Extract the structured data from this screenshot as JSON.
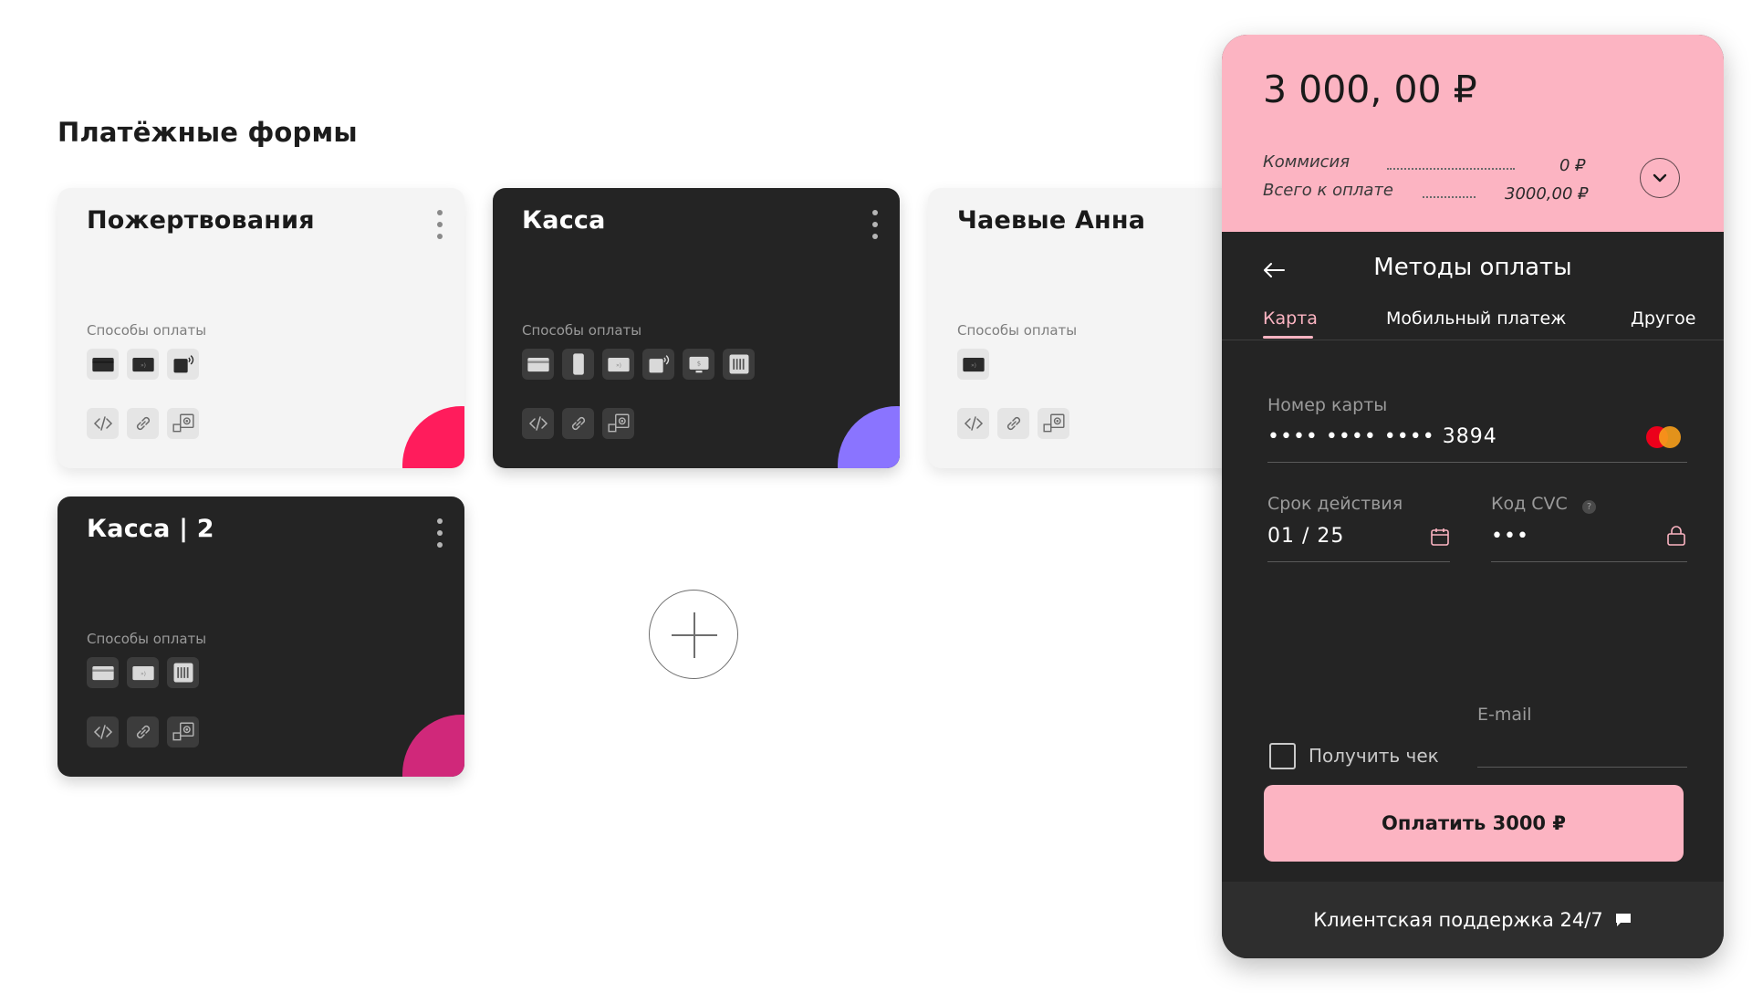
{
  "page": {
    "title": "Платёжные формы"
  },
  "methods_label": "Способы оплаты",
  "colors": {
    "accent_red": "#ff1c5c",
    "accent_violet": "#8a74ff",
    "accent_magenta": "#d0287a",
    "widget_pink": "#fcb4c2",
    "dark": "#242424"
  },
  "cards": [
    {
      "title": "Пожертвования",
      "theme": "light",
      "payment_icons": [
        "card-icon",
        "nfc-card-icon",
        "contactless-icon"
      ],
      "tool_icons": [
        "code-icon",
        "link-icon",
        "qr-icon"
      ]
    },
    {
      "title": "Касса",
      "theme": "dark",
      "payment_icons": [
        "card-icon",
        "phone-icon",
        "nfc-card-icon",
        "contactless-icon",
        "terminal-icon",
        "barcode-icon"
      ],
      "tool_icons": [
        "code-icon",
        "link-icon",
        "qr-icon"
      ]
    },
    {
      "title": "Чаевые Анна",
      "theme": "light",
      "payment_icons": [
        "nfc-card-icon"
      ],
      "tool_icons": [
        "code-icon",
        "link-icon",
        "qr-icon"
      ]
    },
    {
      "title": "Касса | 2",
      "theme": "dark",
      "payment_icons": [
        "card-icon",
        "nfc-card-icon",
        "barcode-icon"
      ],
      "tool_icons": [
        "code-icon",
        "link-icon",
        "qr-icon"
      ]
    }
  ],
  "add_form_icon": "plus-icon",
  "widget": {
    "amount": "3 000, 00 ₽",
    "fee_label": "Коммисия",
    "fee_value": "0 ₽",
    "total_label": "Всего к оплате",
    "total_value": "3000,00 ₽",
    "title": "Методы оплаты",
    "tabs": [
      {
        "label": "Карта",
        "active": true
      },
      {
        "label": "Мобильный платеж",
        "active": false
      },
      {
        "label": "Другое",
        "active": false
      }
    ],
    "card_number_label": "Номер карты",
    "card_number_value": "•••• •••• ••••  3894",
    "expiry_label": "Срок действия",
    "expiry_value": "01 / 25",
    "cvc_label": "Код CVC",
    "cvc_help": "?",
    "cvc_value": "•••",
    "email_label": "E-mail",
    "receipt_label": "Получить чек",
    "pay_button": "Оплатить 3000  ₽",
    "support_label": "Клиентская поддержка 24/7"
  }
}
